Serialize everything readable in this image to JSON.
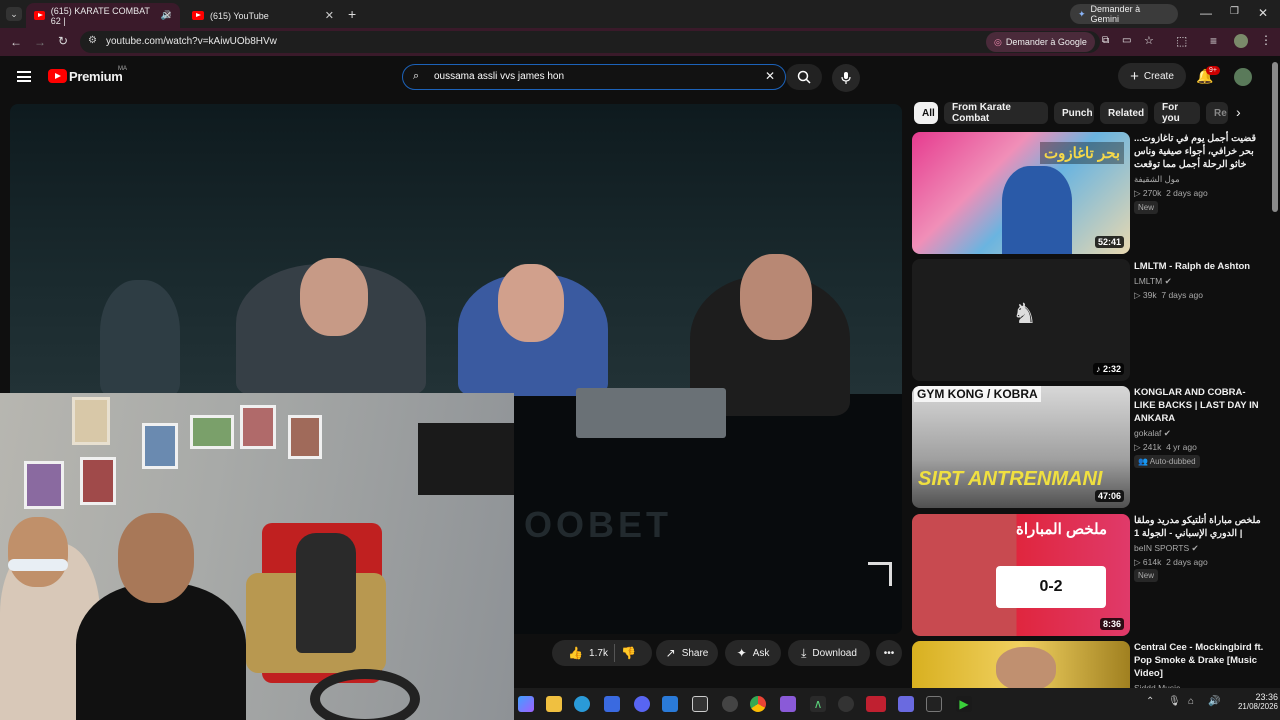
{
  "browser": {
    "tabs": [
      {
        "title": "(615) KARATE COMBAT 62 |",
        "active": true
      },
      {
        "title": "(615) YouTube",
        "active": false
      }
    ],
    "new_tab": "+",
    "gemini_button": "Demander à Gemini",
    "url": "youtube.com/watch?v=kAiwUOb8HVw",
    "ask_google": "Demander à Google"
  },
  "youtube": {
    "logo": "Premium",
    "logo_region": "MA",
    "search_value": "oussama assli vvs james hon",
    "create_label": "Create",
    "notif_count": "9+"
  },
  "video": {
    "overlay_text": "OOBET"
  },
  "actions": {
    "likes": "1.7k",
    "share": "Share",
    "ask": "Ask",
    "download": "Download"
  },
  "chips": [
    "All",
    "From Karate Combat",
    "Punch",
    "Related",
    "For you",
    "Re"
  ],
  "recommendations": [
    {
      "title": "قضيت أجمل يوم في تاغازوت... بحر خرافي، أجواء صيفية وناس خاثو الرحلة أجمل مما توقعت",
      "thumb_text": "بحر تاغازوت",
      "channel": "مول الشقيفة",
      "views": "270k",
      "age": "2 days ago",
      "badge": "New",
      "duration": "52:41",
      "accent": "#e63b8f"
    },
    {
      "title": "LMLTM - Ralph de Ashton",
      "channel": "LMLTM",
      "views": "39k",
      "age": "7 days ago",
      "duration": "2:32",
      "accent": "#1c1c1c"
    },
    {
      "title": "KONGLAR AND COBRA-LIKE BACKS | LAST DAY IN ANKARA",
      "thumb_text": "GYM KONG / KOBRA",
      "thumb_text2": "SIRT ANTRENMANI",
      "channel": "gokalaf",
      "views": "241k",
      "age": "4 yr ago",
      "badge": "Auto-dubbed",
      "duration": "47:06",
      "accent": "#c8c8c8"
    },
    {
      "title": "ملخص مباراة أتلتيكو مدريد وملقا | الدوري الإسباني - الجولة 1",
      "thumb_text": "ملخص المباراة",
      "score": "0-2",
      "channel": "beIN SPORTS",
      "views": "614k",
      "age": "2 days ago",
      "badge": "New",
      "duration": "8:36",
      "accent": "#e0263e"
    },
    {
      "title": "Central Cee - Mockingbird ft. Pop Smoke & Drake [Music Video]",
      "channel": "Siddd Music",
      "accent": "#d8b020"
    }
  ],
  "taskbar": {
    "time": "23:36",
    "date": "21/08/2026"
  },
  "colors": {
    "youtube_red": "#ff0000",
    "search_focus": "#1c62b9",
    "tab_active": "#3a1a2a"
  }
}
